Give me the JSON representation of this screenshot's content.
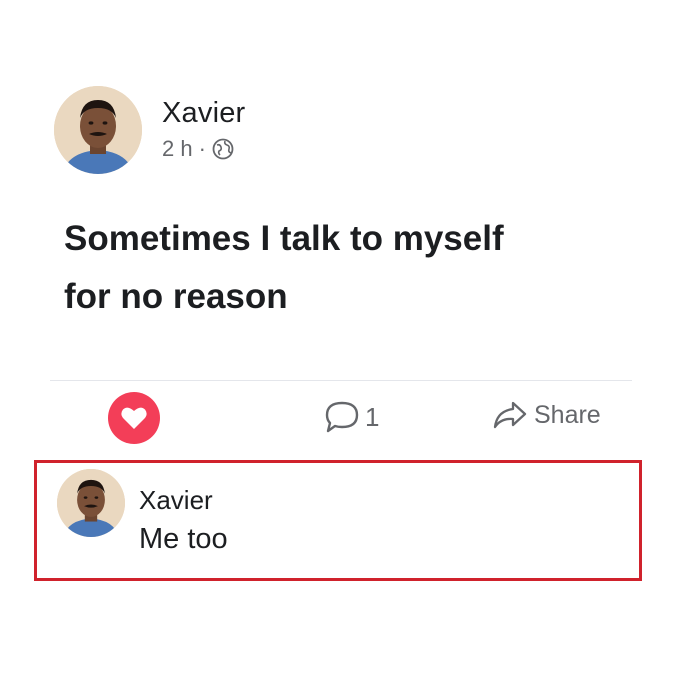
{
  "post": {
    "author": "Xavier",
    "time": "2 h",
    "separator": "·",
    "privacy_icon": "globe-icon",
    "text_line_1": "Sometimes I talk to myself",
    "text_line_2": "for no reason"
  },
  "actions": {
    "like_icon": "heart-icon",
    "comment_icon": "comment-bubble-icon",
    "comment_count": "1",
    "share_icon": "share-arrow-icon",
    "share_label": "Share"
  },
  "comment": {
    "author": "Xavier",
    "text": "Me too"
  },
  "colors": {
    "like_red": "#f33e58",
    "highlight_border": "#d0222c",
    "secondary_text": "#65676b"
  }
}
